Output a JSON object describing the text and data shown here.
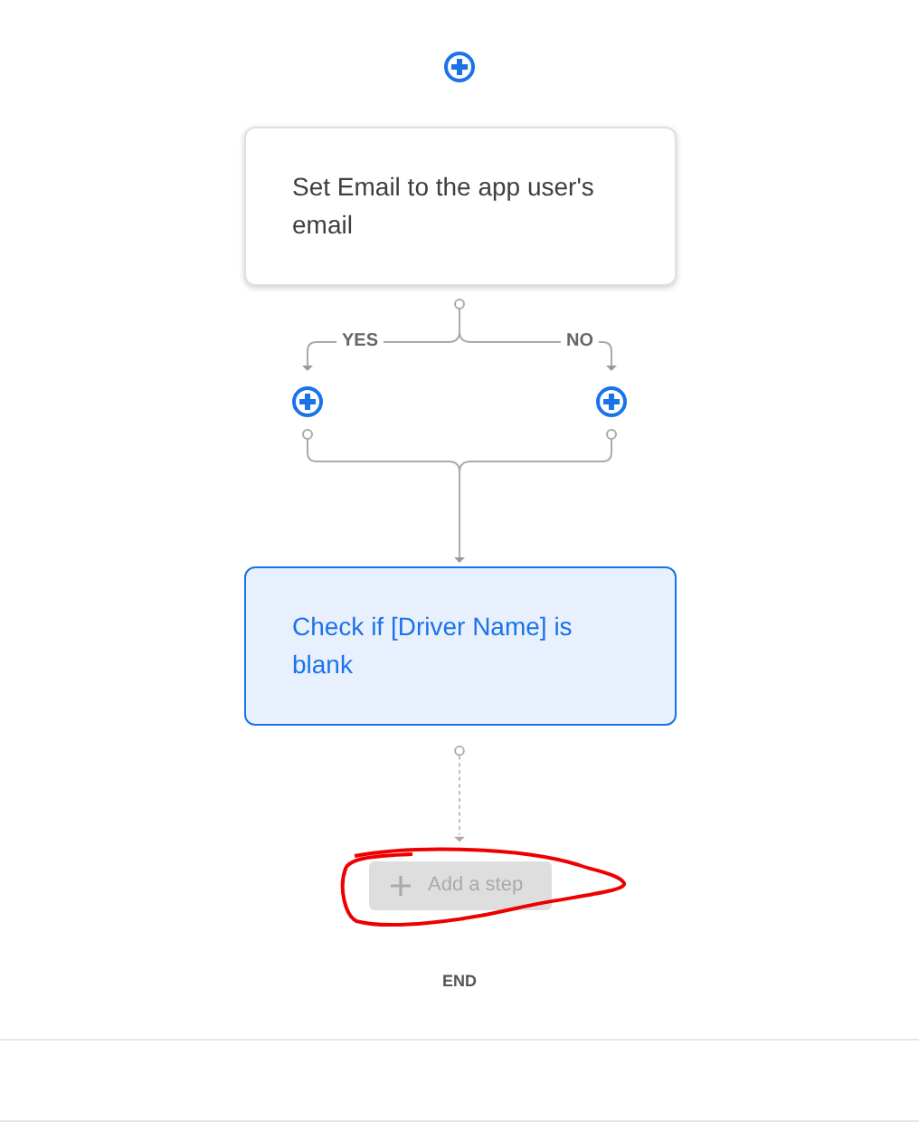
{
  "steps": [
    {
      "text": "Set Email to the app user's email",
      "selected": false
    },
    {
      "text": "Check if [Driver Name] is blank",
      "selected": true
    }
  ],
  "branch": {
    "labels": [
      "YES",
      "NO"
    ]
  },
  "add_step": {
    "label": "Add a step",
    "disabled": true,
    "circled": true
  },
  "end_label": "END"
}
